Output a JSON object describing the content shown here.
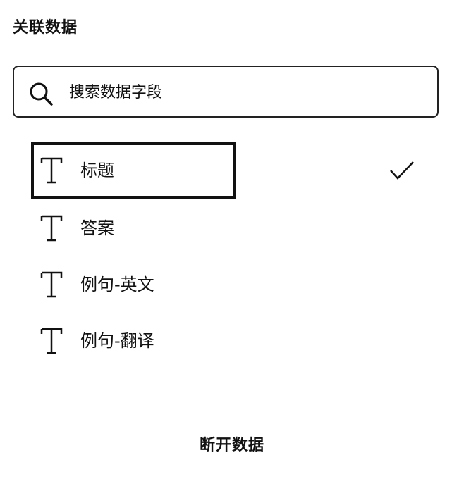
{
  "panel": {
    "title": "关联数据"
  },
  "search": {
    "placeholder": "搜索数据字段",
    "value": ""
  },
  "fields": [
    {
      "label": "标题",
      "type_icon": "text-type-icon",
      "selected": true
    },
    {
      "label": "答案",
      "type_icon": "text-type-icon",
      "selected": false
    },
    {
      "label": "例句-英文",
      "type_icon": "text-type-icon",
      "selected": false
    },
    {
      "label": "例句-翻译",
      "type_icon": "text-type-icon",
      "selected": false
    }
  ],
  "footer": {
    "disconnect_label": "断开数据"
  }
}
